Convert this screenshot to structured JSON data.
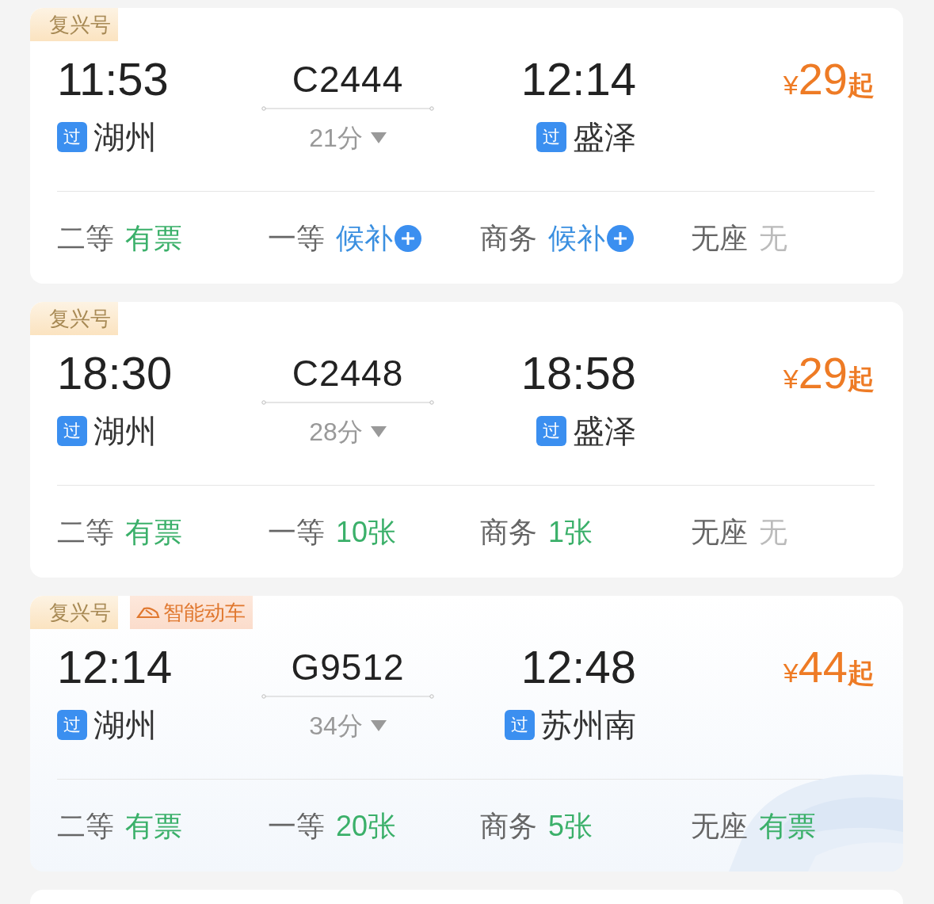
{
  "trains": [
    {
      "tags": [
        {
          "text": "复兴号",
          "kind": "fuxing"
        }
      ],
      "highlighted": false,
      "depart": {
        "time": "11:53",
        "badge": "过",
        "station": "湖州"
      },
      "train_no": "C2444",
      "duration": "21分",
      "arrive": {
        "time": "12:14",
        "badge": "过",
        "station": "盛泽"
      },
      "price": {
        "currency": "¥",
        "amount": "29",
        "suffix": "起"
      },
      "seats": [
        {
          "class": "二等",
          "status": "有票",
          "kind": "available"
        },
        {
          "class": "一等",
          "status": "候补",
          "kind": "waitlist"
        },
        {
          "class": "商务",
          "status": "候补",
          "kind": "waitlist"
        },
        {
          "class": "无座",
          "status": "无",
          "kind": "none"
        }
      ]
    },
    {
      "tags": [
        {
          "text": "复兴号",
          "kind": "fuxing"
        }
      ],
      "highlighted": false,
      "depart": {
        "time": "18:30",
        "badge": "过",
        "station": "湖州"
      },
      "train_no": "C2448",
      "duration": "28分",
      "arrive": {
        "time": "18:58",
        "badge": "过",
        "station": "盛泽"
      },
      "price": {
        "currency": "¥",
        "amount": "29",
        "suffix": "起"
      },
      "seats": [
        {
          "class": "二等",
          "status": "有票",
          "kind": "available"
        },
        {
          "class": "一等",
          "status": "10张",
          "kind": "available"
        },
        {
          "class": "商务",
          "status": "1张",
          "kind": "available"
        },
        {
          "class": "无座",
          "status": "无",
          "kind": "none"
        }
      ]
    },
    {
      "tags": [
        {
          "text": "复兴号",
          "kind": "fuxing"
        },
        {
          "text": "智能动车",
          "kind": "smart"
        }
      ],
      "highlighted": true,
      "depart": {
        "time": "12:14",
        "badge": "过",
        "station": "湖州"
      },
      "train_no": "G9512",
      "duration": "34分",
      "arrive": {
        "time": "12:48",
        "badge": "过",
        "station": "苏州南"
      },
      "price": {
        "currency": "¥",
        "amount": "44",
        "suffix": "起"
      },
      "seats": [
        {
          "class": "二等",
          "status": "有票",
          "kind": "available"
        },
        {
          "class": "一等",
          "status": "20张",
          "kind": "available"
        },
        {
          "class": "商务",
          "status": "5张",
          "kind": "available"
        },
        {
          "class": "无座",
          "status": "有票",
          "kind": "available"
        }
      ]
    }
  ]
}
